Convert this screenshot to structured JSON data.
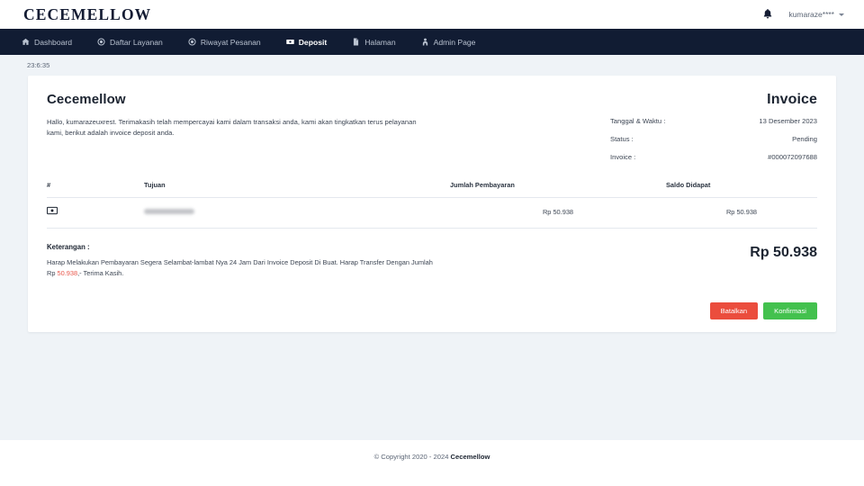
{
  "header": {
    "brand": "CECEMELLOW",
    "bell_icon": "bell-icon",
    "username": "kumaraze****"
  },
  "nav": {
    "items": [
      {
        "label": "Dashboard",
        "icon": "home-icon",
        "active": false
      },
      {
        "label": "Daftar Layanan",
        "icon": "circle-dot-icon",
        "active": false
      },
      {
        "label": "Riwayat Pesanan",
        "icon": "circle-dot-icon",
        "active": false
      },
      {
        "label": "Deposit",
        "icon": "money-bill-icon",
        "active": true
      },
      {
        "label": "Halaman",
        "icon": "file-icon",
        "active": false
      },
      {
        "label": "Admin Page",
        "icon": "user-tie-icon",
        "active": false
      }
    ]
  },
  "clock": "23:6:35",
  "invoice": {
    "shop_name": "Cecemellow",
    "title": "Invoice",
    "greeting": "Hallo, kumarazeuxrest. Terimakasih telah mempercayai kami dalam transaksi anda, kami akan tingkatkan terus pelayanan kami, berikut adalah invoice deposit anda.",
    "meta": [
      {
        "label": "Tanggal & Waktu :",
        "value": "13 Desember 2023"
      },
      {
        "label": "Status :",
        "value": "Pending"
      },
      {
        "label": "Invoice :",
        "value": "#000072097688"
      }
    ],
    "table": {
      "columns": [
        "#",
        "Tujuan",
        "Jumlah Pembayaran",
        "Saldo Didapat"
      ],
      "rows": [
        {
          "num_icon": "money-bill-icon",
          "destination": "",
          "destination_hidden": true,
          "amount": "Rp 50.938",
          "balance": "Rp 50.938"
        }
      ]
    },
    "notes": {
      "title": "Keterangan :",
      "text_before": "Harap Melakukan Pembayaran Segera Selambat-lambat Nya 24 Jam Dari Invoice Deposit Di Buat. Harap Transfer Dengan Jumlah Rp ",
      "text_highlight": "50.938",
      "text_after": ",- Terima Kasih."
    },
    "grand_total": "Rp 50.938",
    "buttons": {
      "cancel": "Batalkan",
      "confirm": "Konfirmasi"
    }
  },
  "footer": {
    "copyright": "© Copyright 2020 - 2024 ",
    "brand": "Cecemellow"
  },
  "colors": {
    "navbar": "#111c33",
    "page_bg": "#eff3f7",
    "cancel": "#eb4d3d",
    "confirm": "#43c14e",
    "highlight": "#e8564a"
  }
}
